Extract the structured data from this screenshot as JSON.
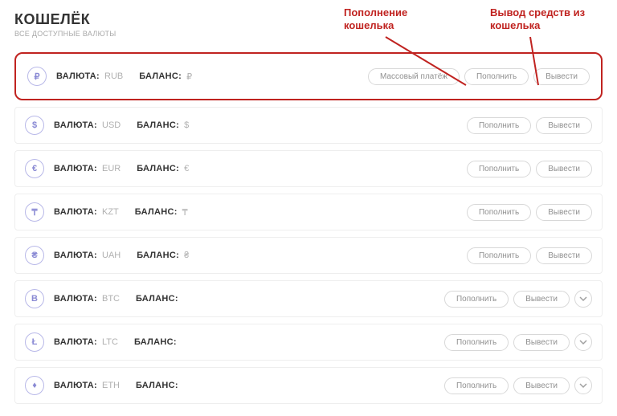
{
  "header": {
    "title": "КОШЕЛЁК",
    "subtitle": "ВСЕ ДОСТУПНЫЕ ВАЛЮТЫ"
  },
  "labels": {
    "currency": "ВАЛЮТА:",
    "balance": "БАЛАНС:"
  },
  "buttons": {
    "mass": "Массовый платёж",
    "deposit": "Пополнить",
    "withdraw": "Вывести"
  },
  "annotations": {
    "deposit": "Пополнение кошелька",
    "withdraw": "Вывод средств из кошелька"
  },
  "rows": [
    {
      "code": "RUB",
      "icon": "₽",
      "symbol": "₽",
      "highlighted": true,
      "mass": true,
      "expand": false
    },
    {
      "code": "USD",
      "icon": "$",
      "symbol": "$",
      "highlighted": false,
      "mass": false,
      "expand": false
    },
    {
      "code": "EUR",
      "icon": "€",
      "symbol": "€",
      "highlighted": false,
      "mass": false,
      "expand": false
    },
    {
      "code": "KZT",
      "icon": "₸",
      "symbol": "₸",
      "highlighted": false,
      "mass": false,
      "expand": false
    },
    {
      "code": "UAH",
      "icon": "₴",
      "symbol": "₴",
      "highlighted": false,
      "mass": false,
      "expand": false
    },
    {
      "code": "BTC",
      "icon": "B",
      "symbol": "",
      "highlighted": false,
      "mass": false,
      "expand": true
    },
    {
      "code": "LTC",
      "icon": "Ł",
      "symbol": "",
      "highlighted": false,
      "mass": false,
      "expand": true
    },
    {
      "code": "ETH",
      "icon": "♦",
      "symbol": "",
      "highlighted": false,
      "mass": false,
      "expand": true
    }
  ]
}
